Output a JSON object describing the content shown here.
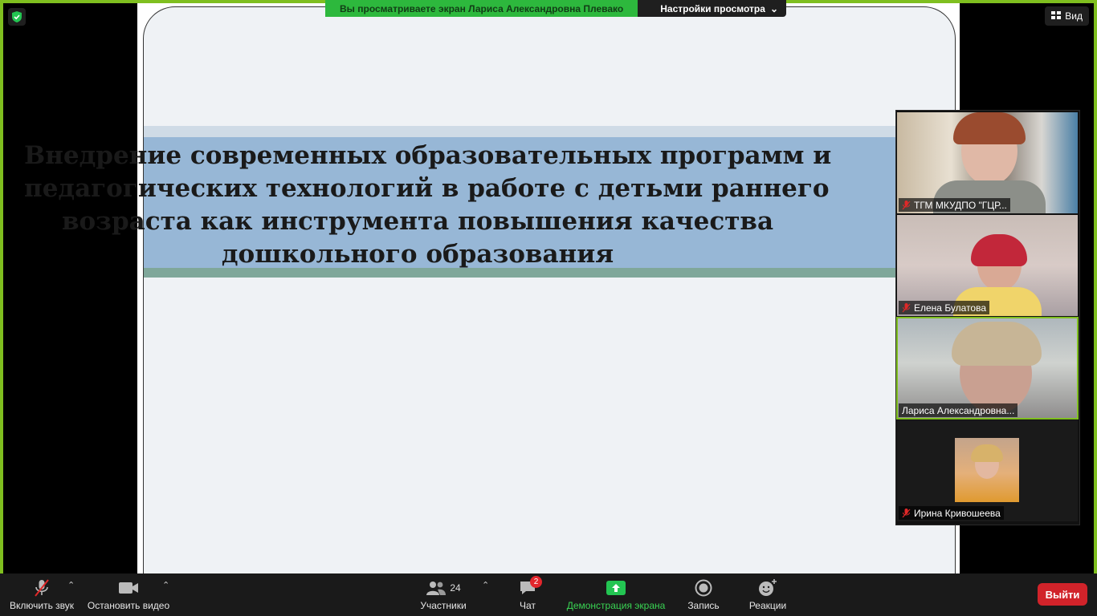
{
  "share_banner": {
    "viewing_text": "Вы просматриваете экран Лариса Александровна Плевако",
    "view_settings": "Настройки просмотра"
  },
  "top_right": {
    "view_label": "Вид"
  },
  "slide": {
    "title_lines": [
      "Внедрение современных образовательных программ и",
      "педагогических технологий в работе с детьми раннего",
      "возраста как инструмента повышения качества",
      "дошкольного образования"
    ]
  },
  "participants_gallery": [
    {
      "name": "ТГМ МКУДПО \"ГЦР...",
      "muted": true
    },
    {
      "name": "Елена Булатова",
      "muted": true
    },
    {
      "name": "Лариса Александровна...",
      "muted": false,
      "active_speaker": true
    },
    {
      "name": "Ирина Кривошеева",
      "muted": true
    }
  ],
  "toolbar": {
    "unmute": "Включить звук",
    "stop_video": "Остановить видео",
    "participants": "Участники",
    "participants_count": "24",
    "chat": "Чат",
    "chat_badge": "2",
    "share_screen": "Демонстрация экрана",
    "record": "Запись",
    "reactions": "Реакции",
    "leave": "Выйти"
  },
  "colors": {
    "share_border": "#7fbf1f",
    "banner_green": "#2db83d",
    "leave_red": "#d1232a",
    "slide_band": "#97b7d6"
  }
}
